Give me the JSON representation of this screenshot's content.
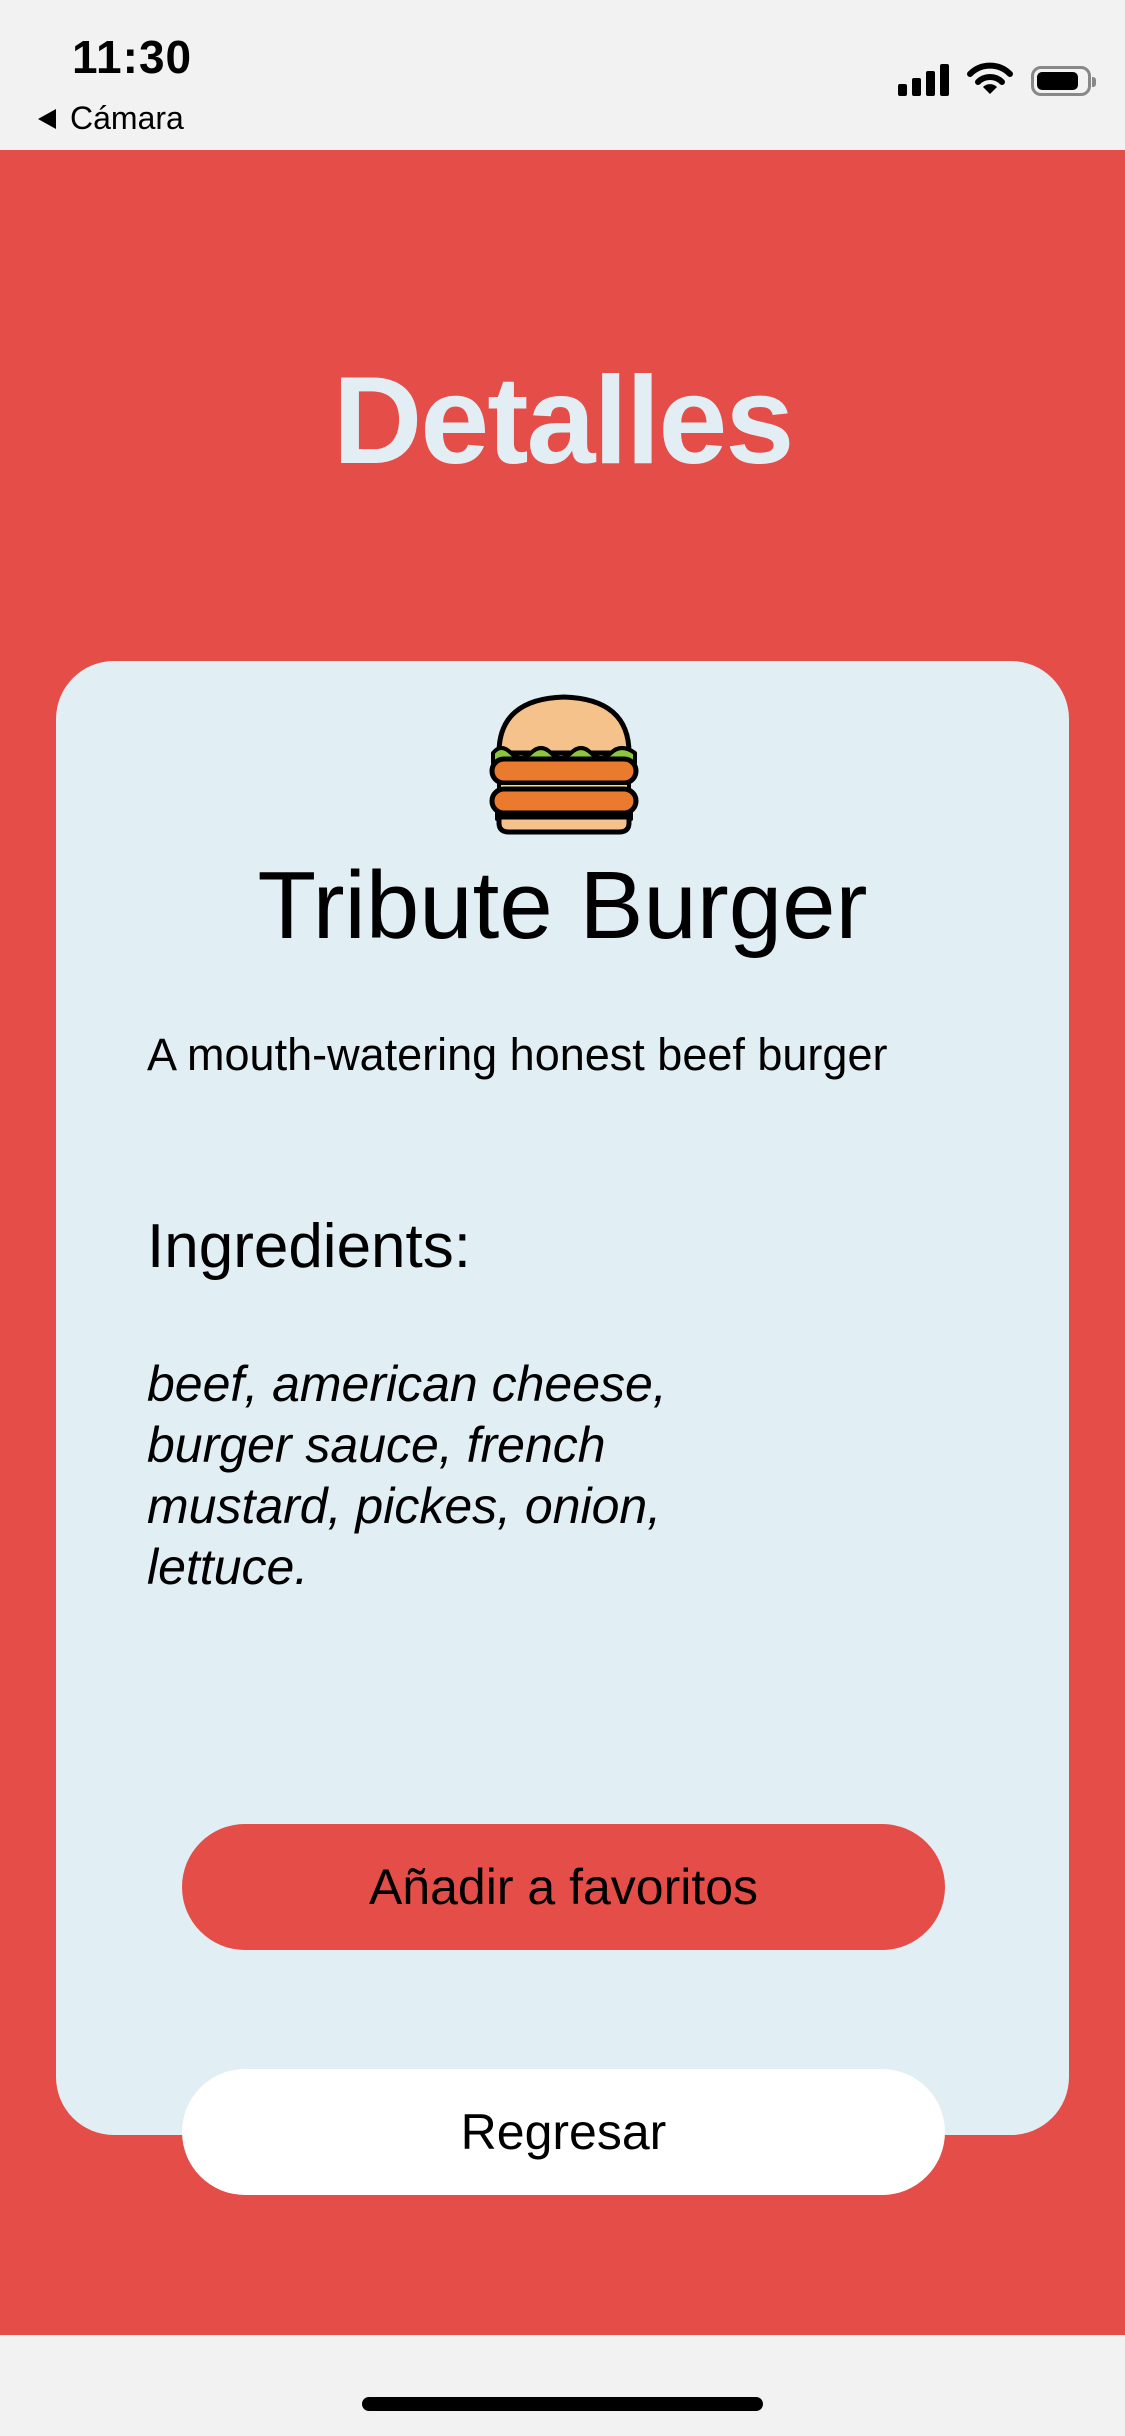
{
  "status_bar": {
    "time": "11:30",
    "back_app_label": "Cámara",
    "icons": [
      "cellular-signal-icon",
      "wifi-icon",
      "battery-icon"
    ],
    "battery_level_fraction": 0.85
  },
  "page": {
    "title": "Detalles",
    "background_color": "#e44d48",
    "title_color": "#e2eef4"
  },
  "card": {
    "background_color": "#e1eef4",
    "icon": "burger-icon",
    "product_name": "Tribute Burger",
    "description": "A mouth-watering honest beef burger",
    "ingredients_heading": "Ingredients:",
    "ingredients": "beef, american cheese, burger sauce, french mustard, pickes, onion, lettuce."
  },
  "actions": {
    "favorite_label": "Añadir a favoritos",
    "back_label": "Regresar"
  }
}
